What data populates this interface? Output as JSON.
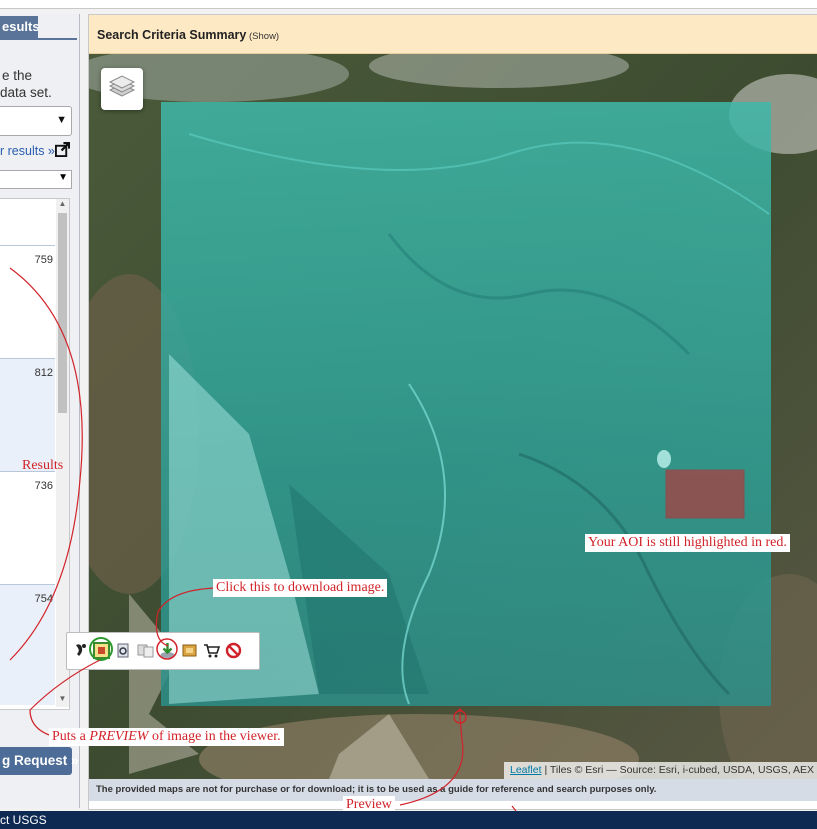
{
  "left_panel": {
    "tab_label": "esults",
    "intro_line1": "e the",
    "intro_line2": "data set.",
    "results_link": "r results »",
    "results_list": {
      "row_ids": [
        "759",
        "812",
        "736",
        "754"
      ]
    },
    "request_button": "g Request »"
  },
  "main": {
    "header_title": "Search Criteria Summary",
    "header_show": "(Show)",
    "map": {
      "attribution_link": "Leaflet",
      "attribution_text": " | Tiles © Esri — Source: Esri, i-cubed, USDA, USGS, AEX",
      "aoi_color": "#d2232a",
      "overlay_color": "#2fd3c7"
    },
    "disclaimer": "The provided maps are not for purchase or for download; it is to be used as a guide for reference and search purposes only."
  },
  "toolbar": {
    "icons": [
      "footprint-icon",
      "preview-icon",
      "metadata-icon",
      "compare-icon",
      "download-icon",
      "bulk-download-icon",
      "cart-icon",
      "exclude-icon"
    ]
  },
  "annotations": {
    "results": "Results",
    "aoi": "Your AOI is still highlighted in red.",
    "download": "Click this to download image.",
    "preview_note_prefix": "Puts a ",
    "preview_note_emph": "PREVIEW",
    "preview_note_suffix": " of image in the viewer.",
    "preview": "Preview"
  },
  "footer": {
    "text": "ct USGS"
  }
}
